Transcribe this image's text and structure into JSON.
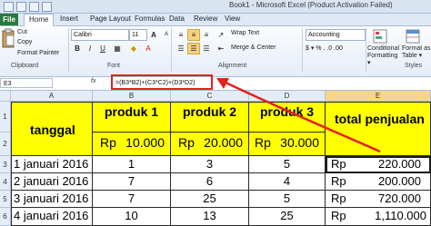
{
  "window": {
    "title": "Book1 - Microsoft Excel (Product Activation Failed)"
  },
  "tabs": [
    {
      "label": "File"
    },
    {
      "label": "Home"
    },
    {
      "label": "Insert"
    },
    {
      "label": "Page Layout"
    },
    {
      "label": "Formulas"
    },
    {
      "label": "Data"
    },
    {
      "label": "Review"
    },
    {
      "label": "View"
    }
  ],
  "ribbon": {
    "cut": "Cut",
    "copy": "Copy",
    "format_painter": "Format Painter",
    "clipboard_group": "Clipboard",
    "font_name": "Calibri",
    "font_size": "11",
    "font_group": "Font",
    "wrap_text": "Wrap Text",
    "merge_center": "Merge & Center",
    "alignment_group": "Alignment",
    "number_format": "Accounting",
    "number_glyphs": "$ ▾  %  ,  .0 .00",
    "conditional_formatting": "Conditional Formatting ▾",
    "format_as_table": "Format as Table ▾",
    "styles_short": "Styles"
  },
  "formula_bar": {
    "name_box": "E3",
    "fx": "fx",
    "formula": "=(B3*B2)+(C3*C2)+(D3*D2)"
  },
  "sheet": {
    "columns": [
      "A",
      "B",
      "C",
      "D",
      "E"
    ],
    "rows": [
      "1",
      "2",
      "3",
      "4",
      "5",
      "6"
    ],
    "header": {
      "tanggal": "tanggal",
      "produk1": "produk 1",
      "produk2": "produk 2",
      "produk3": "produk 3",
      "total": "total penjualan"
    },
    "prices": {
      "rp": "Rp",
      "p1": "10.000",
      "p2": "20.000",
      "p3": "30.000"
    },
    "data": [
      {
        "date": "1 januari 2016",
        "p1": "1",
        "p2": "3",
        "p3": "5",
        "rp": "Rp",
        "total": "220.000"
      },
      {
        "date": "2 januari 2016",
        "p1": "7",
        "p2": "6",
        "p3": "4",
        "rp": "Rp",
        "total": "200.000"
      },
      {
        "date": "3 januari 2016",
        "p1": "7",
        "p2": "25",
        "p3": "5",
        "rp": "Rp",
        "total": "720.000"
      },
      {
        "date": "4 januari 2016",
        "p1": "10",
        "p2": "13",
        "p3": "25",
        "rp": "Rp",
        "total": "1,110.000"
      }
    ]
  },
  "colors": {
    "highlight_yellow": "#ffff00",
    "annotation_red": "#e4201f",
    "file_tab": "#2a7a3c"
  }
}
